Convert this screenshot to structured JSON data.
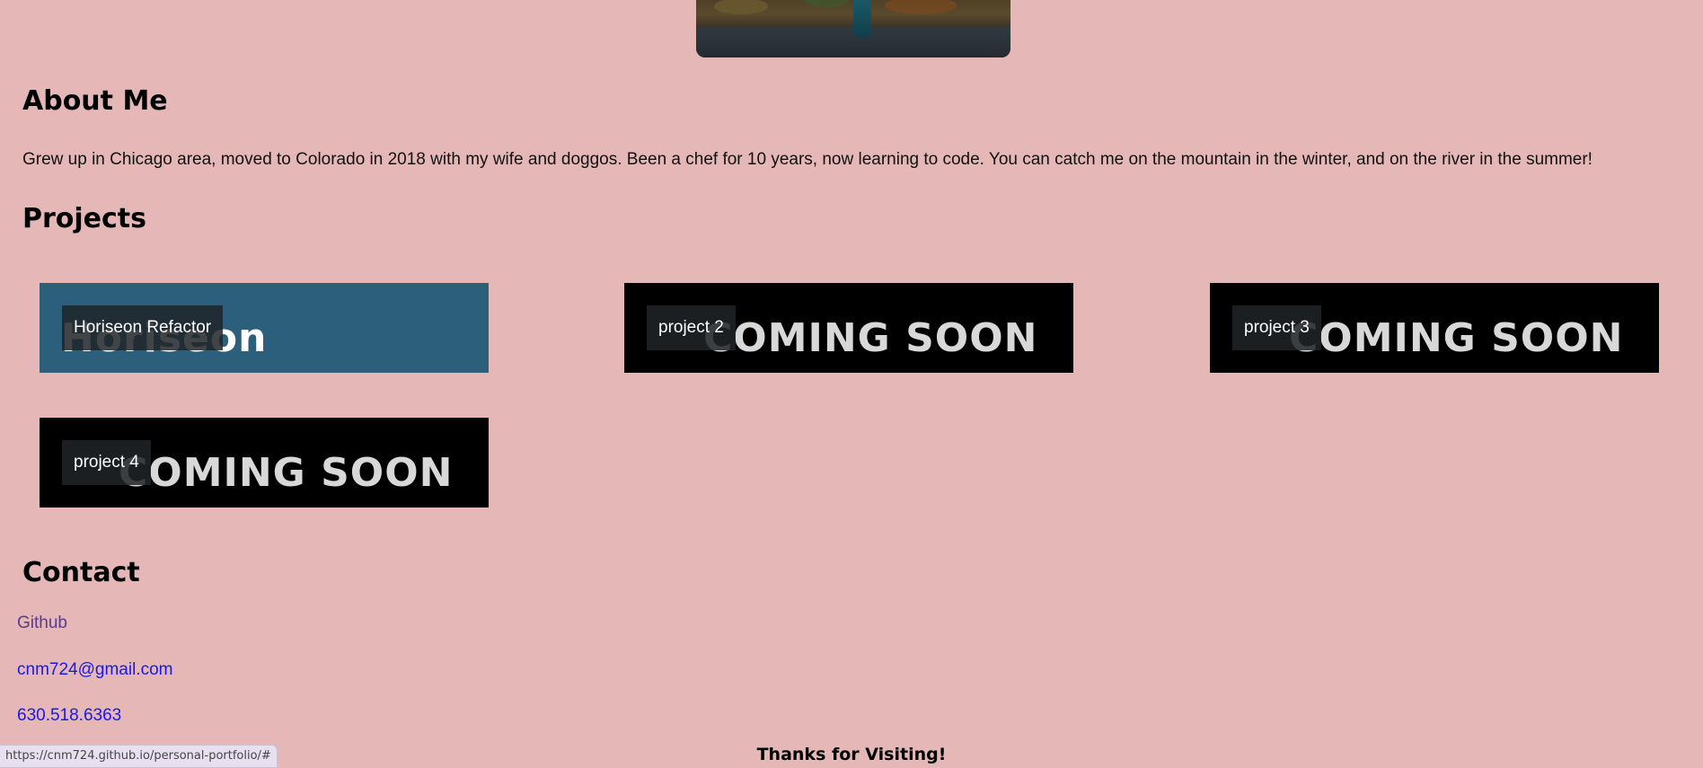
{
  "about": {
    "title": "About Me",
    "text": "Grew up in Chicago area, moved to Colorado in 2018 with my wife and doggos. Been a chef for 10 years, now learning to code. You can catch me on the mountain in the winter, and on the river in the summer!"
  },
  "projects": {
    "title": "Projects",
    "items": [
      {
        "label": "Horiseon Refactor",
        "banner": "Horiseon"
      },
      {
        "label": "project 2",
        "banner": "COMING SOON"
      },
      {
        "label": "project 3",
        "banner": "COMING SOON"
      },
      {
        "label": "project 4",
        "banner": "COMING SOON"
      }
    ]
  },
  "contact": {
    "title": "Contact",
    "github": "Github",
    "email": "cnm724@gmail.com",
    "phone": "630.518.6363"
  },
  "footer": {
    "thanks": "Thanks for Visiting!"
  },
  "status_bar": {
    "url": "https://cnm724.github.io/personal-portfolio/#"
  },
  "colors": {
    "page_background": "#e6b7b7",
    "horiseon_card": "#2b5f7c",
    "coming_soon_card": "#000000",
    "visited_link": "#5b3a8e",
    "link": "#1a18e6"
  }
}
